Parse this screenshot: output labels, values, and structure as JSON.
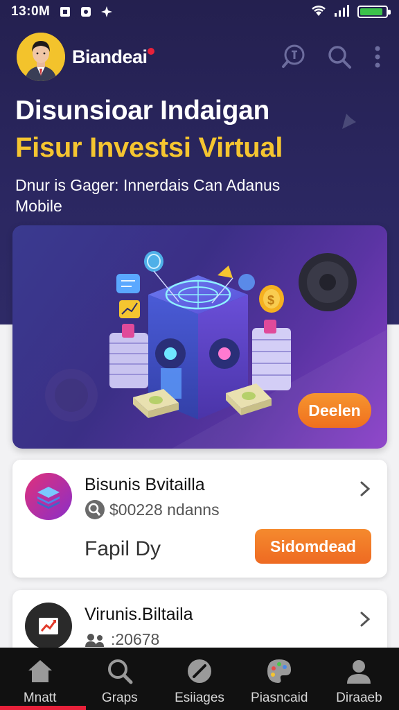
{
  "status_bar": {
    "time": "13:0M",
    "battery_level": 0.9,
    "battery_color": "#3cc24a"
  },
  "header": {
    "brand": "Biandeai",
    "accent": "#e8213a"
  },
  "hero": {
    "title": "Disunsioar Indaigan",
    "subtitle": "Fisur Investsi Virtual",
    "description": "Dnur is Gager: Innerdais Can Adanus Mobile",
    "subtitle_color": "#f5c530"
  },
  "banner": {
    "button_label": "Deelen"
  },
  "cards": [
    {
      "title": "Bisunis Bvitailla",
      "meta": "$00228 ndanns",
      "footer": "Fapil Dy",
      "action_label": "Sidomdead",
      "icon": "layers-icon"
    },
    {
      "title": "Virunis.Biltaila",
      "meta": ":20678",
      "icon": "trend-chart-icon"
    }
  ],
  "nav": {
    "items": [
      {
        "label": "Mnatt",
        "icon": "home-icon"
      },
      {
        "label": "Graps",
        "icon": "search-icon"
      },
      {
        "label": "Esiiages",
        "icon": "compass-icon"
      },
      {
        "label": "Piasncaid",
        "icon": "palette-icon"
      },
      {
        "label": "Diraaeb",
        "icon": "user-icon"
      }
    ],
    "active_index": 0,
    "active_color": "#e8213a"
  }
}
